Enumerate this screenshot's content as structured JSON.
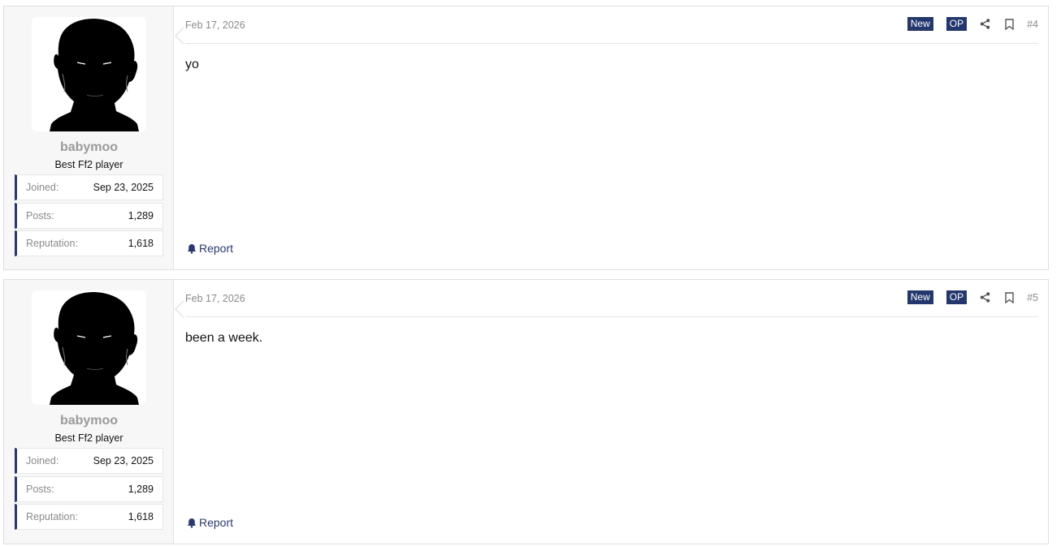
{
  "posts": [
    {
      "user": {
        "name": "babymoo",
        "title": "Best Ff2 player",
        "stats": [
          {
            "label": "Joined:",
            "value": "Sep 23, 2025"
          },
          {
            "label": "Posts:",
            "value": "1,289"
          },
          {
            "label": "Reputation:",
            "value": "1,618"
          }
        ]
      },
      "date": "Feb 17, 2026",
      "badges": {
        "new": "New",
        "op": "OP"
      },
      "number": "#4",
      "content": "yo",
      "report_label": "Report",
      "icons": {
        "share": "share-icon",
        "bookmark": "bookmark-icon",
        "report": "bell-icon"
      }
    },
    {
      "user": {
        "name": "babymoo",
        "title": "Best Ff2 player",
        "stats": [
          {
            "label": "Joined:",
            "value": "Sep 23, 2025"
          },
          {
            "label": "Posts:",
            "value": "1,289"
          },
          {
            "label": "Reputation:",
            "value": "1,618"
          }
        ]
      },
      "date": "Feb 17, 2026",
      "badges": {
        "new": "New",
        "op": "OP"
      },
      "number": "#5",
      "content": "been a week.",
      "report_label": "Report",
      "icons": {
        "share": "share-icon",
        "bookmark": "bookmark-icon",
        "report": "bell-icon"
      }
    }
  ],
  "colors": {
    "accent": "#24376d",
    "link": "#2a3a6e",
    "muted": "#8a8a8a"
  }
}
